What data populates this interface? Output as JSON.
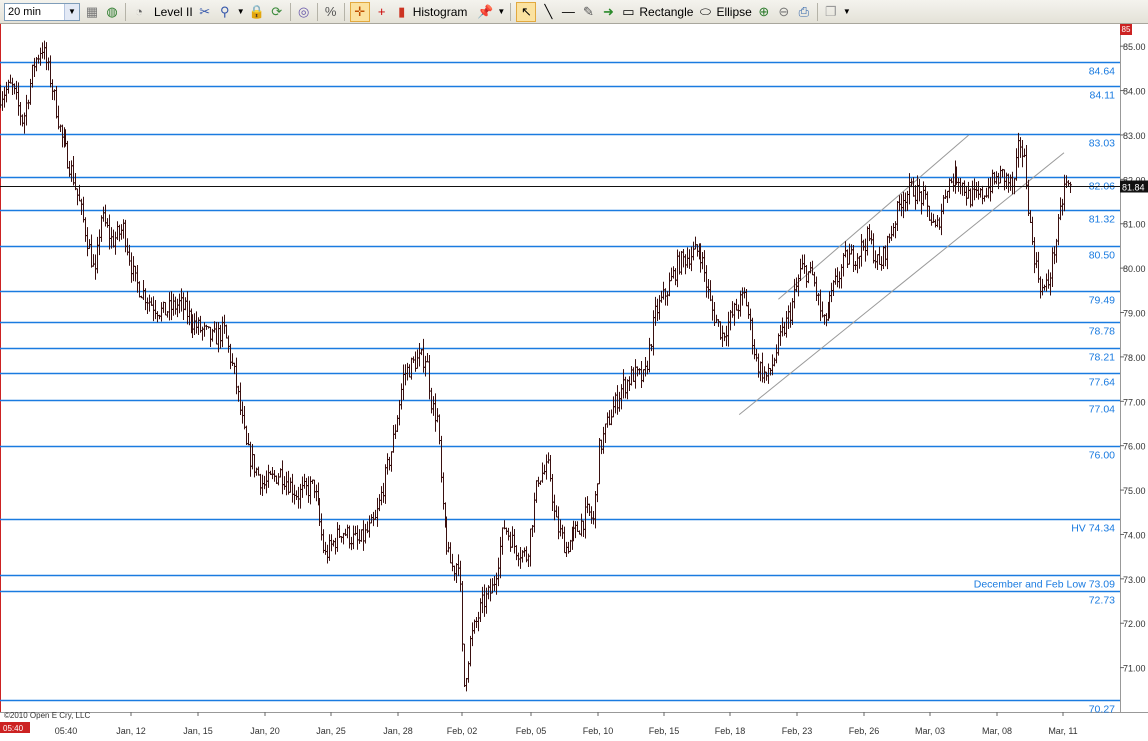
{
  "toolbar": {
    "timeframe": "20 min",
    "level2_label": "Level II",
    "histogram_label": "Histogram",
    "rectangle_label": "Rectangle",
    "ellipse_label": "Ellipse",
    "icons": [
      "grid-icon",
      "globe-icon",
      "clock-icon",
      "scissors-icon",
      "zoom-icon",
      "lock-icon",
      "refresh-icon",
      "link-icon",
      "percent-icon",
      "crosshair-icon",
      "plus-icon",
      "histogram-icon",
      "pin-icon",
      "cursor-icon",
      "line-icon",
      "hline-icon",
      "note-icon",
      "arrow-icon",
      "rectangle-icon",
      "ellipse-icon",
      "zoom-in-icon",
      "zoom-out-icon",
      "print-icon",
      "window-icon"
    ]
  },
  "chart_data": {
    "type": "candlestick",
    "copyright": "©2010 Open E Cry, LLC",
    "start_time": "05:40",
    "ylim": [
      70,
      85.5
    ],
    "y_ticks": [
      "85.00",
      "84.00",
      "83.00",
      "82.00",
      "81.00",
      "80.00",
      "79.00",
      "78.00",
      "77.00",
      "76.00",
      "75.00",
      "74.00",
      "73.00",
      "72.00",
      "71.00"
    ],
    "x_ticks": [
      "05:40",
      "Jan, 12",
      "Jan, 15",
      "Jan, 20",
      "Jan, 25",
      "Jan, 28",
      "Feb, 02",
      "Feb, 05",
      "Feb, 10",
      "Feb, 15",
      "Feb, 18",
      "Feb, 23",
      "Feb, 26",
      "Mar, 03",
      "Mar, 08",
      "Mar, 11"
    ],
    "last_price": "81.84",
    "last_price_value": 81.84,
    "levels": [
      {
        "value": 84.64,
        "label": "84.64"
      },
      {
        "value": 84.11,
        "label": "84.11"
      },
      {
        "value": 83.03,
        "label": "83.03"
      },
      {
        "value": 82.06,
        "label": "82.06"
      },
      {
        "value": 81.32,
        "label": "81.32"
      },
      {
        "value": 80.5,
        "label": "80.50"
      },
      {
        "value": 79.49,
        "label": "79.49"
      },
      {
        "value": 78.78,
        "label": "78.78"
      },
      {
        "value": 78.21,
        "label": "78.21"
      },
      {
        "value": 77.64,
        "label": "77.64"
      },
      {
        "value": 77.04,
        "label": "77.04"
      },
      {
        "value": 76.0,
        "label": "76.00"
      },
      {
        "value": 74.34,
        "label": "HV 74.34"
      },
      {
        "value": 73.09,
        "label": "December and Feb Low 73.09"
      },
      {
        "value": 72.73,
        "label": "72.73"
      },
      {
        "value": 70.27,
        "label": "70.27"
      }
    ],
    "price_path": [
      [
        0,
        83.9
      ],
      [
        0.01,
        84.1
      ],
      [
        0.02,
        83.3
      ],
      [
        0.03,
        84.6
      ],
      [
        0.037,
        85.0
      ],
      [
        0.045,
        84.2
      ],
      [
        0.055,
        82.9
      ],
      [
        0.065,
        82.1
      ],
      [
        0.075,
        81.0
      ],
      [
        0.085,
        79.8
      ],
      [
        0.09,
        81.2
      ],
      [
        0.1,
        80.6
      ],
      [
        0.11,
        80.9
      ],
      [
        0.12,
        79.7
      ],
      [
        0.135,
        79.2
      ],
      [
        0.145,
        79.0
      ],
      [
        0.16,
        79.2
      ],
      [
        0.175,
        78.7
      ],
      [
        0.19,
        78.4
      ],
      [
        0.2,
        78.6
      ],
      [
        0.21,
        77.5
      ],
      [
        0.22,
        75.9
      ],
      [
        0.235,
        75.1
      ],
      [
        0.25,
        75.4
      ],
      [
        0.265,
        74.9
      ],
      [
        0.28,
        75.1
      ],
      [
        0.29,
        73.5
      ],
      [
        0.305,
        74.1
      ],
      [
        0.32,
        73.8
      ],
      [
        0.335,
        74.3
      ],
      [
        0.35,
        76.0
      ],
      [
        0.36,
        77.6
      ],
      [
        0.37,
        77.9
      ],
      [
        0.38,
        78.0
      ],
      [
        0.385,
        76.9
      ],
      [
        0.39,
        76.6
      ],
      [
        0.395,
        74.5
      ],
      [
        0.4,
        73.5
      ],
      [
        0.405,
        73.2
      ],
      [
        0.41,
        73.5
      ],
      [
        0.414,
        70.5
      ],
      [
        0.42,
        71.6
      ],
      [
        0.43,
        72.4
      ],
      [
        0.44,
        72.8
      ],
      [
        0.45,
        74.2
      ],
      [
        0.46,
        73.7
      ],
      [
        0.47,
        73.5
      ],
      [
        0.48,
        75.3
      ],
      [
        0.49,
        75.5
      ],
      [
        0.495,
        74.3
      ],
      [
        0.505,
        73.7
      ],
      [
        0.515,
        74.1
      ],
      [
        0.525,
        74.5
      ],
      [
        0.53,
        74.3
      ],
      [
        0.535,
        75.9
      ],
      [
        0.545,
        76.7
      ],
      [
        0.555,
        77.3
      ],
      [
        0.565,
        77.6
      ],
      [
        0.575,
        77.5
      ],
      [
        0.585,
        79.0
      ],
      [
        0.595,
        79.5
      ],
      [
        0.605,
        80.1
      ],
      [
        0.615,
        80.3
      ],
      [
        0.625,
        80.4
      ],
      [
        0.635,
        79.1
      ],
      [
        0.645,
        78.5
      ],
      [
        0.655,
        79.0
      ],
      [
        0.665,
        79.4
      ],
      [
        0.675,
        77.9
      ],
      [
        0.685,
        77.5
      ],
      [
        0.695,
        78.3
      ],
      [
        0.705,
        79.0
      ],
      [
        0.715,
        80.0
      ],
      [
        0.725,
        79.8
      ],
      [
        0.735,
        78.7
      ],
      [
        0.745,
        79.6
      ],
      [
        0.755,
        80.2
      ],
      [
        0.765,
        80.3
      ],
      [
        0.775,
        80.7
      ],
      [
        0.785,
        80.0
      ],
      [
        0.795,
        80.8
      ],
      [
        0.805,
        81.6
      ],
      [
        0.815,
        81.8
      ],
      [
        0.825,
        81.5
      ],
      [
        0.835,
        80.8
      ],
      [
        0.845,
        81.9
      ],
      [
        0.855,
        82.1
      ],
      [
        0.865,
        81.6
      ],
      [
        0.875,
        81.6
      ],
      [
        0.885,
        81.9
      ],
      [
        0.895,
        82.1
      ],
      [
        0.905,
        81.8
      ],
      [
        0.91,
        82.9
      ],
      [
        0.915,
        82.3
      ],
      [
        0.92,
        80.8
      ],
      [
        0.925,
        80.0
      ],
      [
        0.93,
        79.5
      ],
      [
        0.935,
        79.6
      ],
      [
        0.945,
        81.0
      ],
      [
        0.95,
        81.9
      ],
      [
        0.955,
        81.8
      ]
    ],
    "channel": [
      {
        "x1": 0.695,
        "y1": 79.3,
        "x2": 0.865,
        "y2": 83.0
      },
      {
        "x1": 0.66,
        "y1": 76.7,
        "x2": 0.95,
        "y2": 82.6
      }
    ]
  }
}
